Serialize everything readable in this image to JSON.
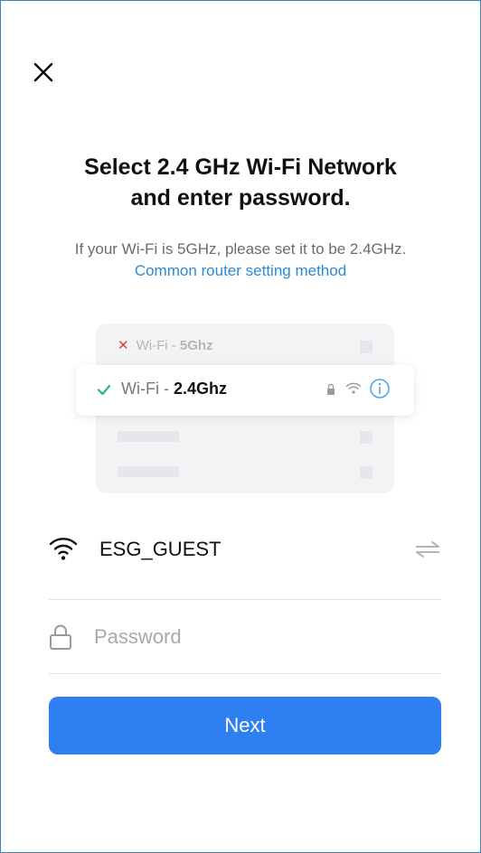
{
  "header": {
    "close_icon": "close-icon"
  },
  "main": {
    "title_line1": "Select 2.4 GHz Wi-Fi Network",
    "title_line2": "and enter password.",
    "subtitle": "If your Wi-Fi is 5GHz, please set it to be 2.4GHz.",
    "link": "Common router setting method"
  },
  "illustration": {
    "row_5ghz": {
      "prefix": "Wi-Fi - ",
      "band": "5Ghz",
      "status_icon": "x-icon"
    },
    "row_24ghz": {
      "prefix": "Wi-Fi - ",
      "band": "2.4Ghz",
      "status_icon": "check-icon"
    }
  },
  "form": {
    "ssid": "ESG_GUEST",
    "password_placeholder": "Password",
    "password_value": "",
    "next_label": "Next"
  },
  "colors": {
    "accent": "#2e7ff0",
    "link": "#2a8ad6",
    "check": "#27b0a3",
    "error": "#e23b3b"
  }
}
